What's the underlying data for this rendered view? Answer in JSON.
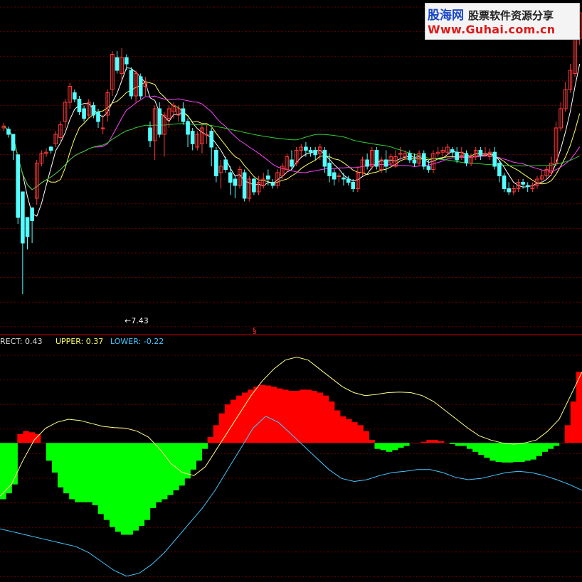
{
  "colors": {
    "background": "#000000",
    "up_candle": "#ff3a3a",
    "down_candle": "#54ffff",
    "ma_white": "#ffffff",
    "ma_yellow": "#ffff66",
    "ma_magenta": "#ff44ff",
    "ma_green": "#33cc33",
    "grid": "#6b0000",
    "separator": "#c80000",
    "osc_positive": "#ff0000",
    "osc_negative": "#00ff00",
    "upper_line": "#ffff88",
    "lower_line": "#44c8ff"
  },
  "watermark": {
    "brand": "股海网",
    "tagline": "股票软件资源分享",
    "url": "Www.Guhai.com.cn"
  },
  "price_panel": {
    "low_marker_text": "←7.43",
    "separator_symbol": "§"
  },
  "indicator_legend": {
    "rect_label": "RECT: 0.43",
    "upper_label": "UPPER: 0.37",
    "lower_label": "LOWER: -0.22"
  },
  "chart_data": [
    {
      "type": "candlestick",
      "title": "",
      "low_annotation": 7.43,
      "candles": [
        [
          300,
          303,
          308,
          295
        ],
        [
          298,
          290,
          302,
          285
        ],
        [
          290,
          265,
          270,
          250
        ],
        [
          258,
          160,
          165,
          150
        ],
        [
          200,
          120,
          125,
          40
        ],
        [
          160,
          130,
          135,
          110
        ],
        [
          175,
          155,
          160,
          120
        ],
        [
          190,
          245,
          250,
          180
        ],
        [
          245,
          260,
          265,
          240
        ],
        [
          260,
          262,
          268,
          255
        ],
        [
          270,
          265,
          272,
          260
        ],
        [
          275,
          290,
          295,
          270
        ],
        [
          285,
          305,
          310,
          280
        ],
        [
          310,
          340,
          345,
          300
        ],
        [
          340,
          365,
          370,
          330
        ],
        [
          355,
          345,
          360,
          340
        ],
        [
          345,
          325,
          350,
          320
        ],
        [
          330,
          315,
          335,
          310
        ],
        [
          320,
          340,
          345,
          315
        ],
        [
          335,
          320,
          340,
          315
        ],
        [
          325,
          310,
          330,
          300
        ],
        [
          300,
          300,
          320,
          290
        ],
        [
          320,
          355,
          360,
          310
        ],
        [
          360,
          415,
          420,
          350
        ],
        [
          410,
          390,
          420,
          385
        ],
        [
          385,
          410,
          425,
          375
        ],
        [
          410,
          400,
          415,
          390
        ],
        [
          390,
          350,
          395,
          345
        ],
        [
          350,
          385,
          390,
          340
        ],
        [
          380,
          350,
          385,
          345
        ],
        [
          365,
          370,
          380,
          350
        ],
        [
          300,
          280,
          310,
          270
        ],
        [
          280,
          330,
          335,
          250
        ],
        [
          330,
          290,
          340,
          285
        ],
        [
          290,
          320,
          325,
          255
        ],
        [
          315,
          330,
          335,
          300
        ],
        [
          325,
          335,
          340,
          315
        ],
        [
          320,
          330,
          335,
          310
        ],
        [
          330,
          310,
          340,
          305
        ],
        [
          310,
          290,
          315,
          270
        ],
        [
          295,
          275,
          300,
          265
        ],
        [
          270,
          290,
          295,
          265
        ],
        [
          275,
          300,
          305,
          260
        ],
        [
          290,
          290,
          305,
          275
        ],
        [
          295,
          270,
          300,
          240
        ],
        [
          265,
          225,
          270,
          215
        ],
        [
          230,
          240,
          250,
          205
        ],
        [
          250,
          235,
          255,
          230
        ],
        [
          230,
          215,
          240,
          195
        ],
        [
          220,
          210,
          225,
          190
        ],
        [
          210,
          235,
          240,
          205
        ],
        [
          230,
          190,
          235,
          185
        ],
        [
          190,
          220,
          225,
          185
        ],
        [
          220,
          200,
          222,
          195
        ],
        [
          200,
          215,
          225,
          195
        ],
        [
          210,
          220,
          230,
          205
        ],
        [
          225,
          220,
          235,
          210
        ],
        [
          215,
          210,
          220,
          205
        ],
        [
          210,
          230,
          235,
          205
        ],
        [
          225,
          240,
          245,
          220
        ],
        [
          235,
          255,
          260,
          230
        ],
        [
          250,
          240,
          265,
          235
        ],
        [
          245,
          265,
          270,
          240
        ],
        [
          265,
          270,
          275,
          255
        ],
        [
          270,
          265,
          278,
          255
        ],
        [
          265,
          262,
          270,
          255
        ],
        [
          265,
          258,
          270,
          250
        ],
        [
          260,
          270,
          275,
          250
        ],
        [
          265,
          240,
          270,
          230
        ],
        [
          245,
          225,
          260,
          215
        ],
        [
          230,
          220,
          235,
          210
        ],
        [
          225,
          225,
          230,
          215
        ],
        [
          222,
          220,
          230,
          210
        ],
        [
          220,
          215,
          225,
          210
        ],
        [
          215,
          205,
          220,
          200
        ],
        [
          205,
          230,
          240,
          200
        ],
        [
          230,
          250,
          255,
          225
        ],
        [
          250,
          240,
          260,
          235
        ],
        [
          240,
          265,
          270,
          235
        ],
        [
          265,
          240,
          270,
          235
        ],
        [
          235,
          250,
          255,
          230
        ],
        [
          250,
          240,
          265,
          230
        ],
        [
          245,
          255,
          260,
          240
        ],
        [
          240,
          255,
          265,
          238
        ],
        [
          260,
          260,
          270,
          250
        ],
        [
          255,
          260,
          265,
          250
        ],
        [
          260,
          250,
          265,
          245
        ],
        [
          250,
          245,
          260,
          240
        ],
        [
          245,
          260,
          265,
          240
        ],
        [
          260,
          240,
          265,
          235
        ],
        [
          240,
          235,
          250,
          230
        ],
        [
          235,
          260,
          265,
          230
        ],
        [
          260,
          262,
          270,
          255
        ],
        [
          262,
          265,
          270,
          255
        ],
        [
          262,
          270,
          275,
          258
        ],
        [
          266,
          262,
          270,
          255
        ],
        [
          262,
          250,
          270,
          245
        ],
        [
          255,
          262,
          270,
          250
        ],
        [
          260,
          245,
          265,
          240
        ],
        [
          245,
          255,
          260,
          240
        ],
        [
          255,
          265,
          270,
          250
        ],
        [
          265,
          258,
          270,
          250
        ],
        [
          258,
          260,
          270,
          255
        ],
        [
          255,
          262,
          268,
          250
        ],
        [
          262,
          240,
          270,
          235
        ],
        [
          245,
          225,
          250,
          215
        ],
        [
          225,
          205,
          230,
          200
        ],
        [
          205,
          200,
          215,
          195
        ],
        [
          200,
          205,
          210,
          195
        ],
        [
          205,
          215,
          220,
          200
        ],
        [
          215,
          212,
          220,
          205
        ],
        [
          210,
          208,
          215,
          200
        ],
        [
          205,
          210,
          215,
          200
        ],
        [
          210,
          220,
          225,
          205
        ],
        [
          220,
          225,
          235,
          215
        ],
        [
          225,
          235,
          240,
          220
        ],
        [
          230,
          245,
          255,
          225
        ],
        [
          245,
          300,
          310,
          240
        ],
        [
          300,
          330,
          340,
          295
        ],
        [
          330,
          360,
          372,
          325
        ],
        [
          360,
          390,
          400,
          355
        ],
        [
          385,
          440,
          450,
          380
        ],
        [
          440,
          480,
          495,
          430
        ]
      ]
    },
    {
      "type": "bar",
      "title": "",
      "series_names": [
        "RECT",
        "UPPER",
        "LOWER"
      ],
      "rect_values": [
        -0.95,
        -0.85,
        -0.7,
        0.15,
        0.2,
        0.18,
        0.15,
        0.0,
        -0.3,
        -0.5,
        -0.75,
        -0.85,
        -0.95,
        -1.0,
        -1.0,
        -1.0,
        -1.05,
        -1.2,
        -1.3,
        -1.42,
        -1.5,
        -1.55,
        -1.55,
        -1.48,
        -1.4,
        -1.3,
        -1.1,
        -1.0,
        -0.95,
        -0.88,
        -0.8,
        -0.72,
        -0.6,
        -0.45,
        -0.3,
        -0.1,
        0.1,
        0.3,
        0.5,
        0.65,
        0.73,
        0.8,
        0.85,
        0.9,
        0.95,
        0.98,
        0.97,
        0.95,
        0.92,
        0.9,
        0.88,
        0.88,
        0.9,
        0.9,
        0.88,
        0.85,
        0.8,
        0.7,
        0.55,
        0.45,
        0.4,
        0.35,
        0.3,
        0.2,
        0.05,
        -0.1,
        -0.12,
        -0.15,
        -0.12,
        -0.08,
        -0.05,
        0.0,
        0.0,
        0.02,
        0.05,
        0.05,
        0.03,
        0.0,
        -0.02,
        -0.05,
        -0.05,
        -0.1,
        -0.15,
        -0.2,
        -0.25,
        -0.3,
        -0.32,
        -0.33,
        -0.33,
        -0.32,
        -0.32,
        -0.3,
        -0.28,
        -0.22,
        -0.15,
        -0.1,
        -0.05,
        0.0,
        0.3,
        0.7,
        1.2
      ],
      "upper_values": [
        -0.9,
        -0.7,
        -0.3,
        0.05,
        0.25,
        0.35,
        0.4,
        0.38,
        0.33,
        0.28,
        0.26,
        0.25,
        0.2,
        0.1,
        -0.1,
        -0.35,
        -0.5,
        -0.55,
        -0.4,
        -0.1,
        0.2,
        0.5,
        0.8,
        1.05,
        1.25,
        1.4,
        1.45,
        1.4,
        1.25,
        1.1,
        0.95,
        0.85,
        0.8,
        0.82,
        0.85,
        0.86,
        0.85,
        0.8,
        0.7,
        0.55,
        0.4,
        0.25,
        0.12,
        0.05,
        0.0,
        -0.02,
        0.0,
        0.05,
        0.2,
        0.4,
        0.8,
        1.2
      ],
      "lower_values": [
        -1.45,
        -1.5,
        -1.55,
        -1.6,
        -1.65,
        -1.7,
        -1.75,
        -1.85,
        -2.0,
        -2.15,
        -2.25,
        -2.2,
        -2.05,
        -1.85,
        -1.6,
        -1.35,
        -1.1,
        -0.8,
        -0.45,
        -0.1,
        0.25,
        0.45,
        0.35,
        0.15,
        -0.05,
        -0.25,
        -0.45,
        -0.6,
        -0.65,
        -0.62,
        -0.55,
        -0.5,
        -0.48,
        -0.45,
        -0.45,
        -0.5,
        -0.58,
        -0.62,
        -0.6,
        -0.55,
        -0.5,
        -0.48,
        -0.5,
        -0.55,
        -0.62,
        -0.7,
        -0.8
      ],
      "ylim": [
        -2.3,
        1.6
      ]
    }
  ]
}
